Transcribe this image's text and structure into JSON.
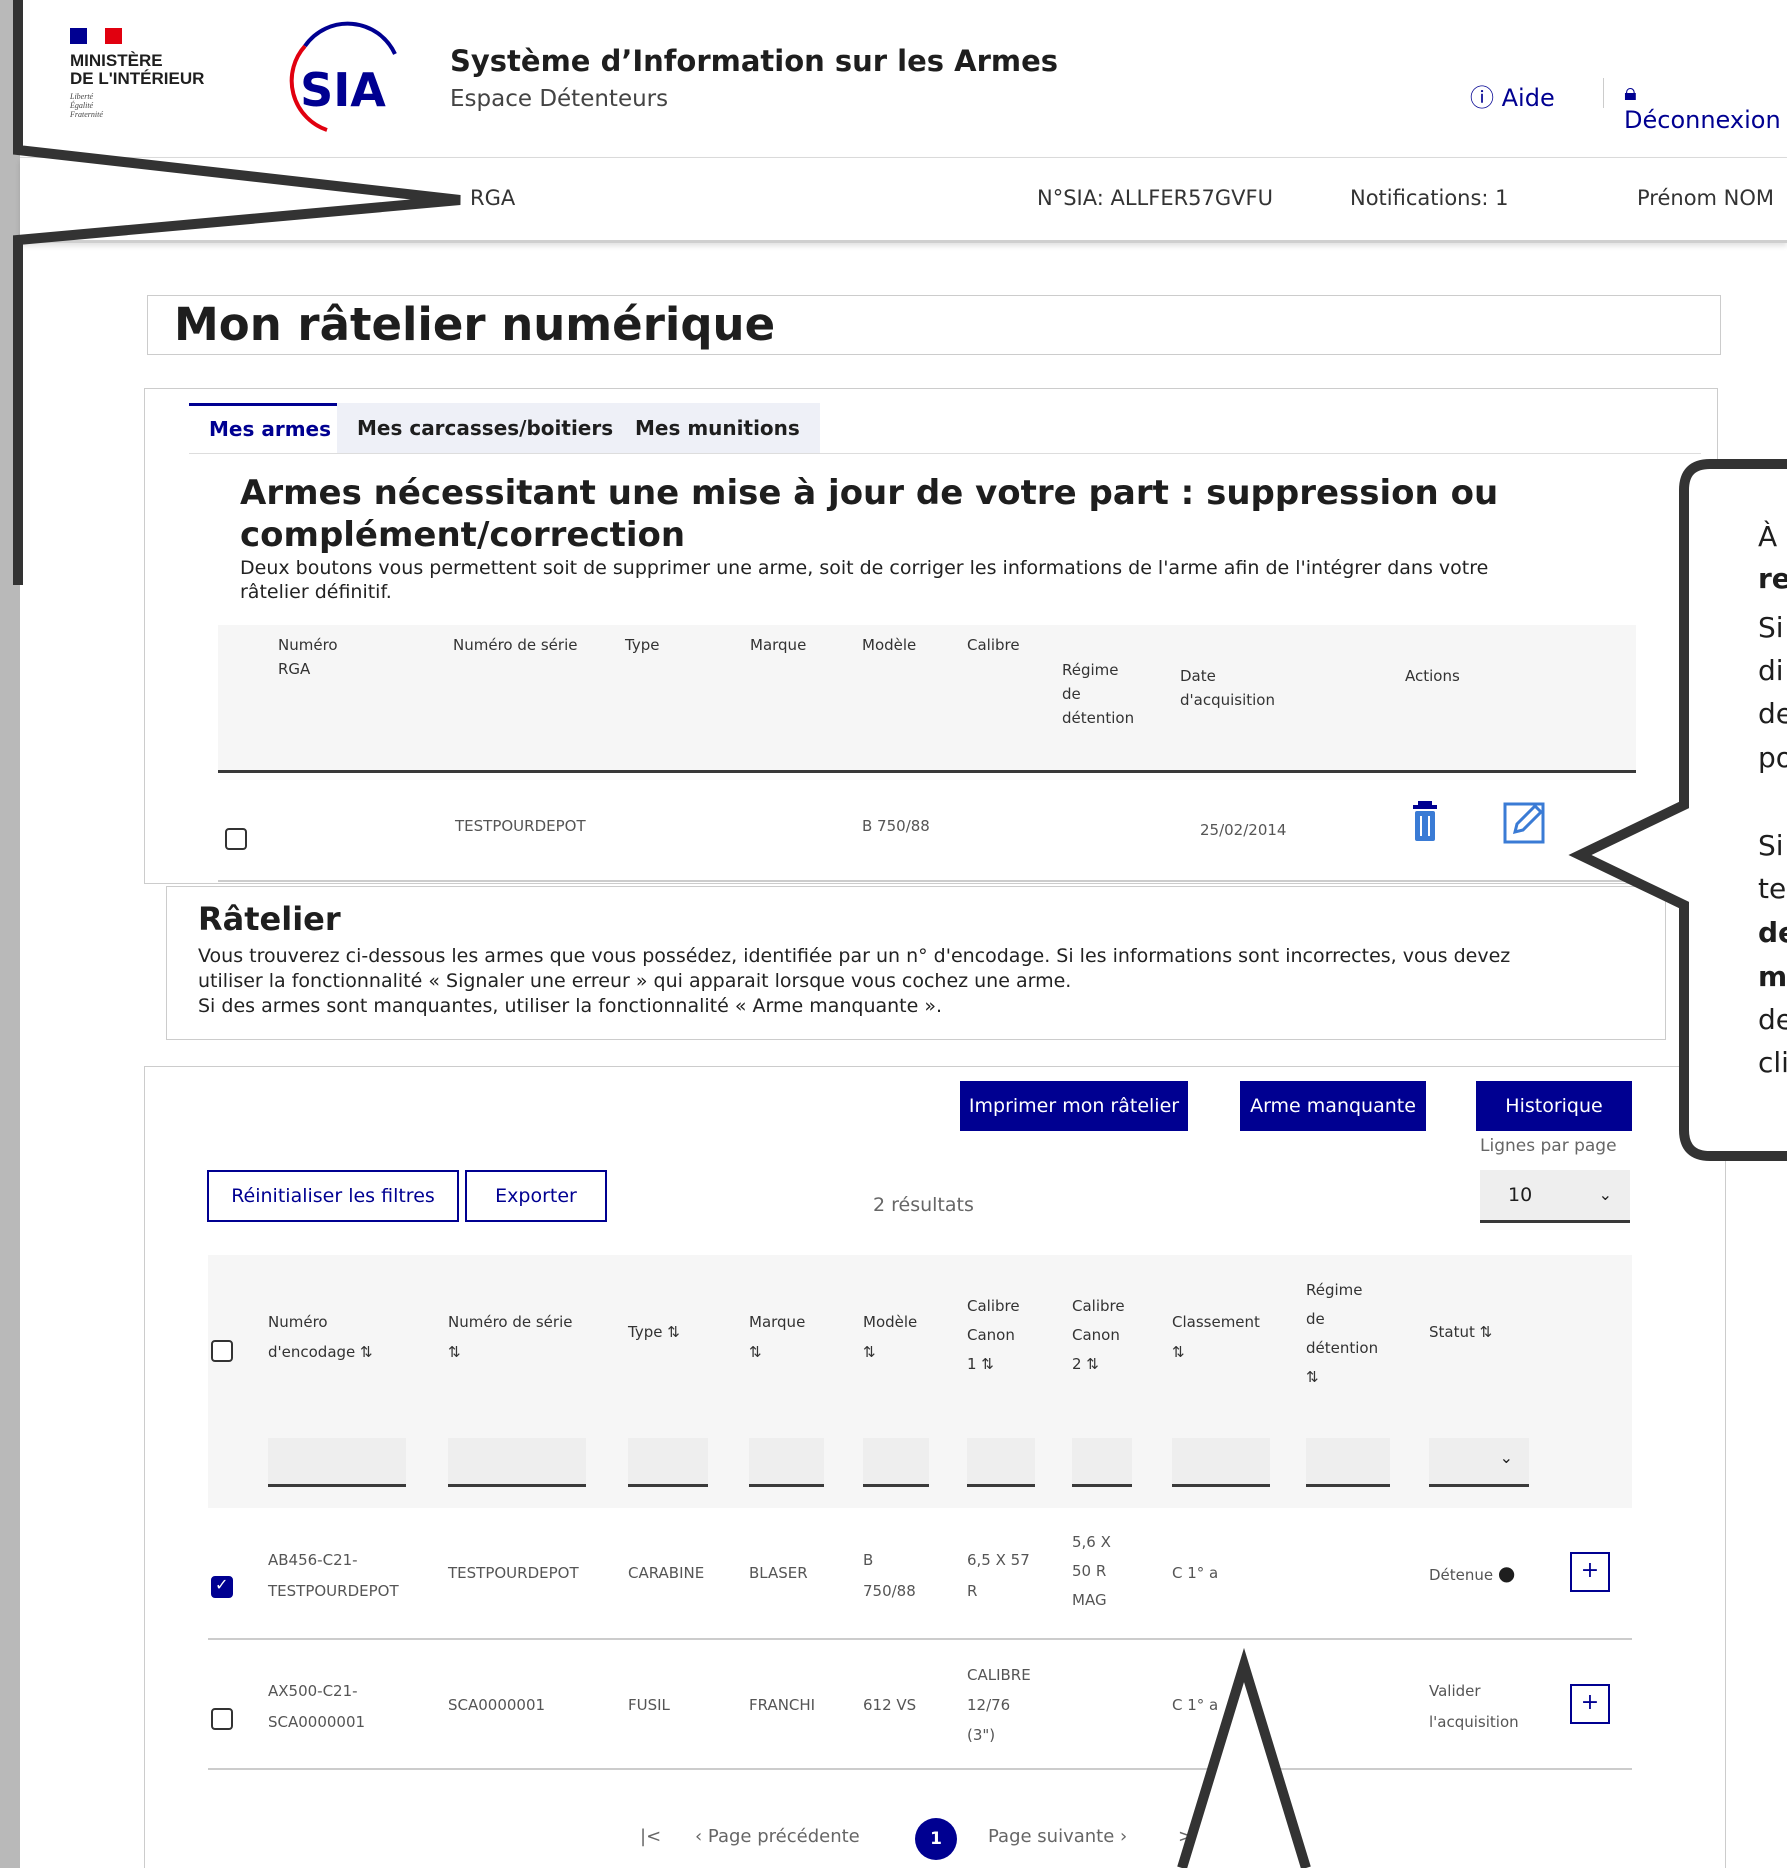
{
  "ministry": {
    "lines": [
      "MINISTÈRE",
      "DE L'INTÉRIEUR"
    ],
    "devise": [
      "Liberté",
      "Égalité",
      "Fraternité"
    ]
  },
  "logo": {
    "text": "SIA"
  },
  "app": {
    "title": "Système d’Information sur les Armes",
    "subtitle": "Espace Détenteurs"
  },
  "nav": {
    "aide": "Aide",
    "logout": "Déconnexion"
  },
  "subheader": {
    "rga": "RGA",
    "sia_number": "N°SIA: ALLFER57GVFU",
    "notifications": "Notifications: 1",
    "user": "Prénom NOM"
  },
  "page_title": "Mon râtelier numérique",
  "tabs": [
    "Mes armes",
    "Mes carcasses/boitiers",
    "Mes munitions"
  ],
  "update_section": {
    "title_line1": "Armes nécessitant une mise à jour de votre part : suppression ou",
    "title_line2": "complément/correction",
    "desc_line1": "Deux boutons vous permettent soit de supprimer une arme, soit de corriger les informations de  l'arme afin de l'intégrer dans votre",
    "desc_line2": "râtelier définitif.",
    "headers": {
      "numero_1": "Numéro",
      "numero_2": "RGA",
      "serie": "Numéro de série",
      "type": "Type",
      "marque": "Marque",
      "modele": "Modèle",
      "calibre": "Calibre",
      "regime_1": "Régime",
      "regime_2": "de",
      "regime_3": "détention",
      "date_1": "Date",
      "date_2": "d'acquisition",
      "actions": "Actions"
    },
    "row": {
      "serie": "TESTPOURDEPOT",
      "modele": "B 750/88",
      "date": "25/02/2014"
    }
  },
  "ratelier": {
    "title": "Râtelier",
    "line1": "Vous trouverez ci-dessous les armes que vous possédez, identifiée par un n° d'encodage. Si les informations sont incorrectes, vous devez",
    "line2": "utiliser la fonctionnalité « Signaler une erreur » qui apparait lorsque vous cochez une arme.",
    "line3": "Si des armes sont manquantes, utiliser la fonctionnalité « Arme manquante »."
  },
  "toolbar": {
    "print": "Imprimer mon râtelier",
    "missing": "Arme manquante",
    "history": "Historique",
    "reset": "Réinitialiser les filtres",
    "export": "Exporter",
    "results": "2 résultats",
    "rows_label": "Lignes par page",
    "rows_value": "10"
  },
  "table_headers": {
    "enc_1": "Numéro",
    "enc_2": "d'encodage ⇅",
    "serie_1": "Numéro de série",
    "serie_2": "⇅",
    "type": "Type ⇅",
    "marque_1": "Marque",
    "marque_2": "⇅",
    "modele_1": "Modèle",
    "modele_2": "⇅",
    "c1_1": "Calibre",
    "c1_2": "Canon",
    "c1_3": "1 ⇅",
    "c2_1": "Calibre",
    "c2_2": "Canon",
    "c2_3": "2 ⇅",
    "classement_1": "Classement",
    "classement_2": "⇅",
    "regime_1": "Régime",
    "regime_2": "de",
    "regime_3": "détention",
    "regime_4": "⇅",
    "statut": "Statut ⇅"
  },
  "rows": [
    {
      "enc_1": "AB456-C21-",
      "enc_2": "TESTPOURDEPOT",
      "serie": "TESTPOURDEPOT",
      "type": "CARABINE",
      "marque": "BLASER",
      "modele_1": "B",
      "modele_2": "750/88",
      "c1_1": "6,5 X 57",
      "c1_2": "R",
      "c2_1": "5,6 X",
      "c2_2": "50 R",
      "c2_3": "MAG",
      "classement": "C 1° a",
      "statut": "Détenue"
    },
    {
      "enc_1": "AX500-C21-",
      "enc_2": "SCA0000001",
      "serie": "SCA0000001",
      "type": "FUSIL",
      "marque": "FRANCHI",
      "modele_1": "612 VS",
      "c1_1": "CALIBRE",
      "c1_2": "12/76",
      "c1_3": "(3\")",
      "classement": "C 1° a",
      "statut_1": "Valider",
      "statut_2": "l'acquisition"
    }
  ],
  "pagination": {
    "prev": "Page précédente",
    "current": "1",
    "next": "Page suivante"
  },
  "callout": {
    "line_a": "À",
    "line_b": "re",
    "line_c": "Si",
    "line_d": "di",
    "line_e": "de",
    "line_f": "po",
    "line_g": "Si",
    "line_h": "te",
    "line_i": "de",
    "line_j": "m",
    "line_k": "de",
    "line_l": "cli"
  },
  "colors": {
    "primary": "#000091",
    "danger": "#e1000f",
    "callout_border": "#333333"
  }
}
